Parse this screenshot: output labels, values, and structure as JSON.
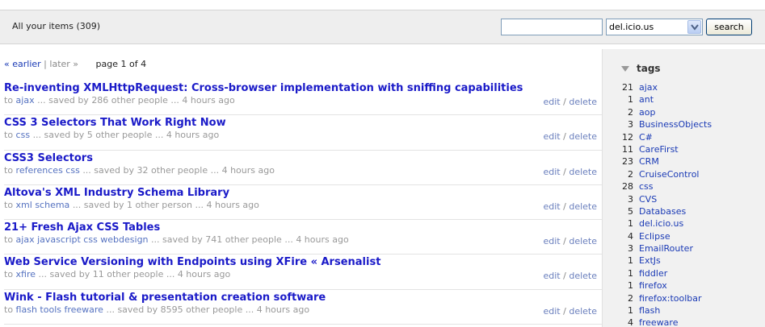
{
  "header": {
    "title": "All your items (309)",
    "search_placeholder": "",
    "select_value": "del.icio.us",
    "search_label": "search"
  },
  "pager": {
    "earlier": "« earlier",
    "sep": "|",
    "later": "later »",
    "page_info": "page 1 of 4"
  },
  "items": [
    {
      "title": "Re-inventing XMLHttpRequest: Cross-browser implementation with sniffing capabilities",
      "prefix": "to",
      "tags": "ajax",
      "saved": "... saved by 286 other people ... 4 hours ago",
      "edit": "edit",
      "slash": "/",
      "delete": "delete"
    },
    {
      "title": "CSS 3 Selectors That Work Right Now",
      "prefix": "to",
      "tags": "css",
      "saved": "... saved by 5 other people ... 4 hours ago",
      "edit": "edit",
      "slash": "/",
      "delete": "delete"
    },
    {
      "title": "CSS3 Selectors",
      "prefix": "to",
      "tags": "references css",
      "saved": "... saved by 32 other people ... 4 hours ago",
      "edit": "edit",
      "slash": "/",
      "delete": "delete"
    },
    {
      "title": "Altova's XML Industry Schema Library",
      "prefix": "to",
      "tags": "xml schema",
      "saved": "... saved by 1 other person ... 4 hours ago",
      "edit": "edit",
      "slash": "/",
      "delete": "delete"
    },
    {
      "title": "21+ Fresh Ajax CSS Tables",
      "prefix": "to",
      "tags": "ajax javascript css webdesign",
      "saved": "... saved by 741 other people ... 4 hours ago",
      "edit": "edit",
      "slash": "/",
      "delete": "delete"
    },
    {
      "title": "Web Service Versioning with Endpoints using XFire « Arsenalist",
      "prefix": "to",
      "tags": "xfire",
      "saved": "... saved by 11 other people ... 4 hours ago",
      "edit": "edit",
      "slash": "/",
      "delete": "delete"
    },
    {
      "title": "Wink - Flash tutorial & presentation creation software",
      "prefix": "to",
      "tags": "flash tools freeware",
      "saved": "... saved by 8595 other people ... 4 hours ago",
      "edit": "edit",
      "slash": "/",
      "delete": "delete"
    }
  ],
  "sidebar": {
    "heading": "tags",
    "tags": [
      {
        "count": "21",
        "name": "ajax"
      },
      {
        "count": "1",
        "name": "ant"
      },
      {
        "count": "2",
        "name": "aop"
      },
      {
        "count": "3",
        "name": "BusinessObjects"
      },
      {
        "count": "12",
        "name": "C#"
      },
      {
        "count": "11",
        "name": "CareFirst"
      },
      {
        "count": "23",
        "name": "CRM"
      },
      {
        "count": "2",
        "name": "CruiseControl"
      },
      {
        "count": "28",
        "name": "css"
      },
      {
        "count": "3",
        "name": "CVS"
      },
      {
        "count": "5",
        "name": "Databases"
      },
      {
        "count": "1",
        "name": "del.icio.us"
      },
      {
        "count": "4",
        "name": "Eclipse"
      },
      {
        "count": "3",
        "name": "EmailRouter"
      },
      {
        "count": "1",
        "name": "ExtJs"
      },
      {
        "count": "1",
        "name": "fiddler"
      },
      {
        "count": "1",
        "name": "firefox"
      },
      {
        "count": "2",
        "name": "firefox:toolbar"
      },
      {
        "count": "1",
        "name": "flash"
      },
      {
        "count": "4",
        "name": "freeware"
      }
    ]
  }
}
